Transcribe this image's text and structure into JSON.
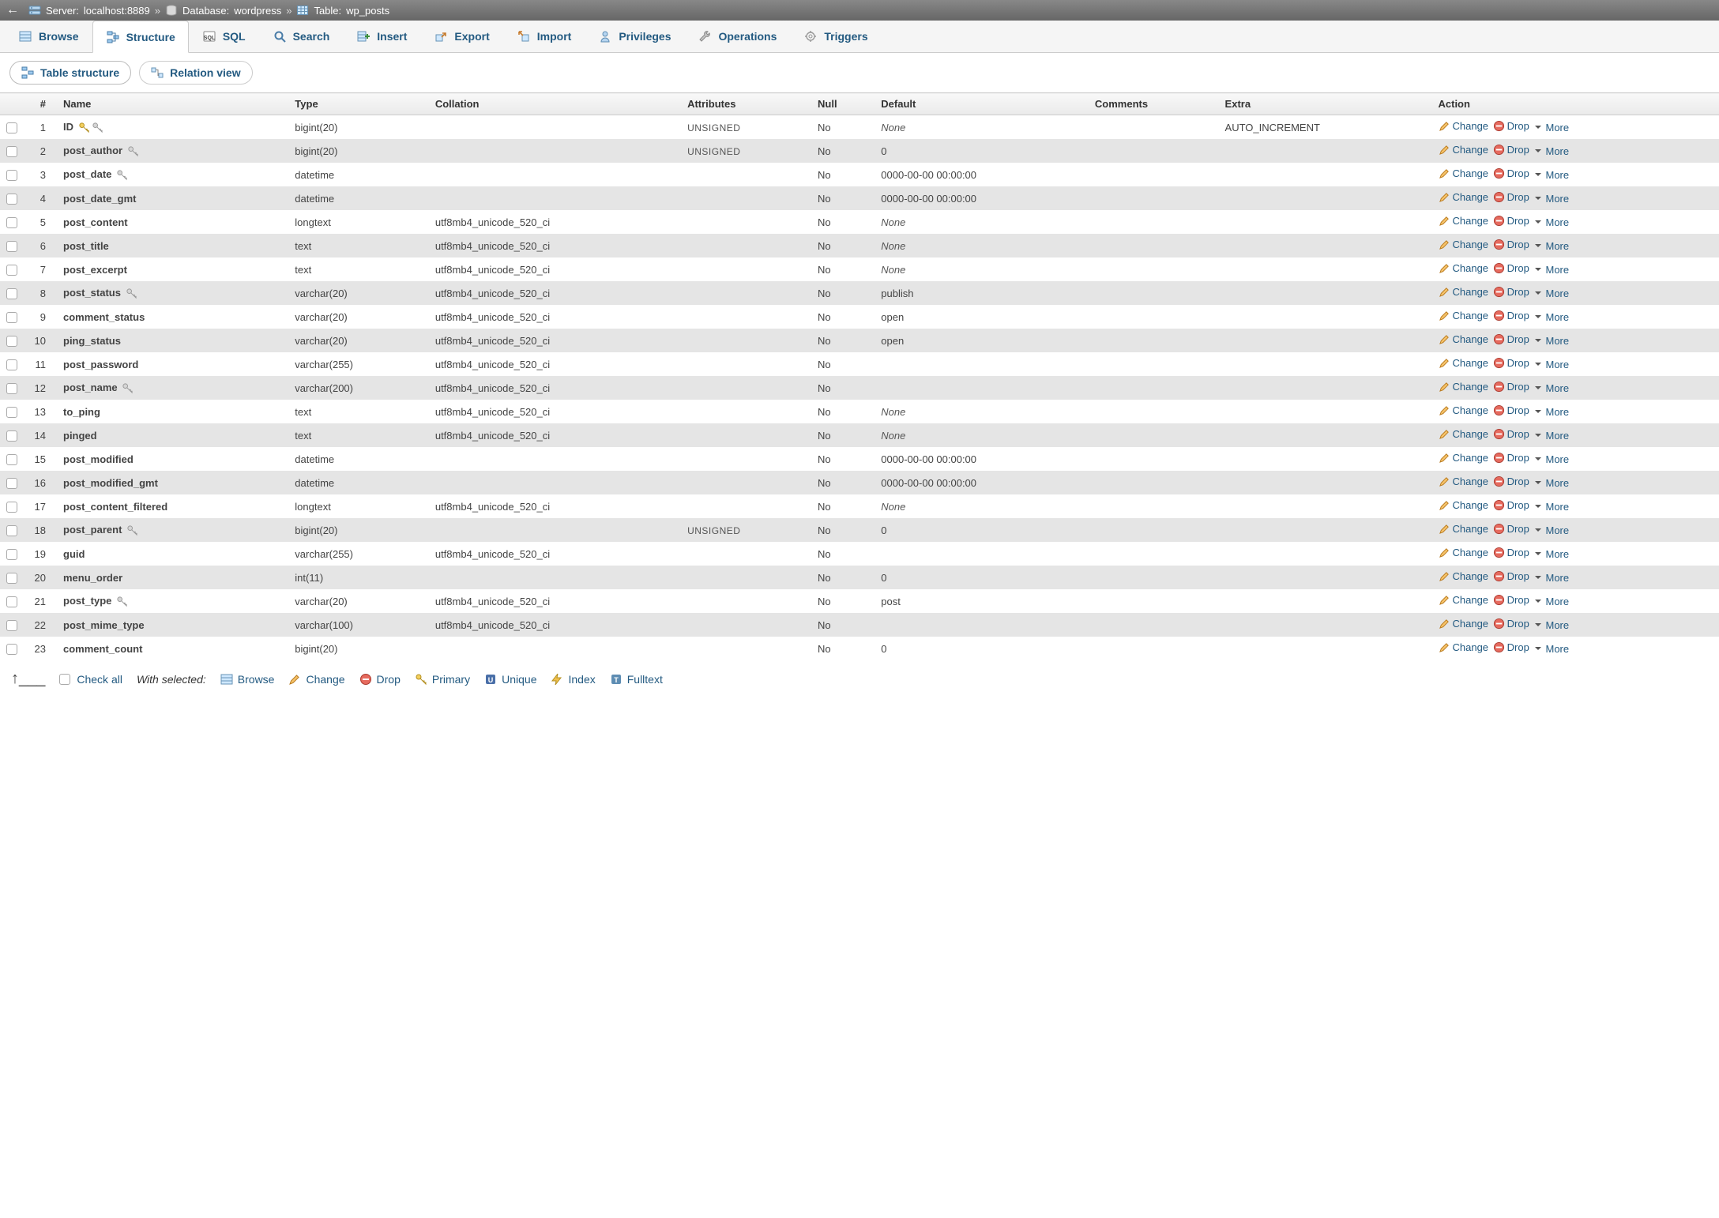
{
  "breadcrumb": {
    "server_label": "Server:",
    "server_value": "localhost:8889",
    "database_label": "Database:",
    "database_value": "wordpress",
    "table_label": "Table:",
    "table_value": "wp_posts"
  },
  "topnav": {
    "browse": "Browse",
    "structure": "Structure",
    "sql": "SQL",
    "search": "Search",
    "insert": "Insert",
    "export": "Export",
    "import": "Import",
    "privileges": "Privileges",
    "operations": "Operations",
    "triggers": "Triggers"
  },
  "subtabs": {
    "table_structure": "Table structure",
    "relation_view": "Relation view"
  },
  "headers": {
    "num": "#",
    "name": "Name",
    "type": "Type",
    "collation": "Collation",
    "attributes": "Attributes",
    "null": "Null",
    "default": "Default",
    "comments": "Comments",
    "extra": "Extra",
    "action": "Action"
  },
  "action_labels": {
    "change": "Change",
    "drop": "Drop",
    "more": "More"
  },
  "columns": [
    {
      "n": "1",
      "name": "ID",
      "type": "bigint(20)",
      "collation": "",
      "attributes": "UNSIGNED",
      "null": "No",
      "default": "None",
      "default_is_none": true,
      "extra": "AUTO_INCREMENT",
      "primary": true,
      "index": true
    },
    {
      "n": "2",
      "name": "post_author",
      "type": "bigint(20)",
      "collation": "",
      "attributes": "UNSIGNED",
      "null": "No",
      "default": "0",
      "default_is_none": false,
      "extra": "",
      "index": true
    },
    {
      "n": "3",
      "name": "post_date",
      "type": "datetime",
      "collation": "",
      "attributes": "",
      "null": "No",
      "default": "0000-00-00 00:00:00",
      "default_is_none": false,
      "extra": "",
      "index": true
    },
    {
      "n": "4",
      "name": "post_date_gmt",
      "type": "datetime",
      "collation": "",
      "attributes": "",
      "null": "No",
      "default": "0000-00-00 00:00:00",
      "default_is_none": false,
      "extra": ""
    },
    {
      "n": "5",
      "name": "post_content",
      "type": "longtext",
      "collation": "utf8mb4_unicode_520_ci",
      "attributes": "",
      "null": "No",
      "default": "None",
      "default_is_none": true,
      "extra": ""
    },
    {
      "n": "6",
      "name": "post_title",
      "type": "text",
      "collation": "utf8mb4_unicode_520_ci",
      "attributes": "",
      "null": "No",
      "default": "None",
      "default_is_none": true,
      "extra": ""
    },
    {
      "n": "7",
      "name": "post_excerpt",
      "type": "text",
      "collation": "utf8mb4_unicode_520_ci",
      "attributes": "",
      "null": "No",
      "default": "None",
      "default_is_none": true,
      "extra": ""
    },
    {
      "n": "8",
      "name": "post_status",
      "type": "varchar(20)",
      "collation": "utf8mb4_unicode_520_ci",
      "attributes": "",
      "null": "No",
      "default": "publish",
      "default_is_none": false,
      "extra": "",
      "index": true
    },
    {
      "n": "9",
      "name": "comment_status",
      "type": "varchar(20)",
      "collation": "utf8mb4_unicode_520_ci",
      "attributes": "",
      "null": "No",
      "default": "open",
      "default_is_none": false,
      "extra": ""
    },
    {
      "n": "10",
      "name": "ping_status",
      "type": "varchar(20)",
      "collation": "utf8mb4_unicode_520_ci",
      "attributes": "",
      "null": "No",
      "default": "open",
      "default_is_none": false,
      "extra": ""
    },
    {
      "n": "11",
      "name": "post_password",
      "type": "varchar(255)",
      "collation": "utf8mb4_unicode_520_ci",
      "attributes": "",
      "null": "No",
      "default": "",
      "default_is_none": false,
      "extra": ""
    },
    {
      "n": "12",
      "name": "post_name",
      "type": "varchar(200)",
      "collation": "utf8mb4_unicode_520_ci",
      "attributes": "",
      "null": "No",
      "default": "",
      "default_is_none": false,
      "extra": "",
      "index": true
    },
    {
      "n": "13",
      "name": "to_ping",
      "type": "text",
      "collation": "utf8mb4_unicode_520_ci",
      "attributes": "",
      "null": "No",
      "default": "None",
      "default_is_none": true,
      "extra": ""
    },
    {
      "n": "14",
      "name": "pinged",
      "type": "text",
      "collation": "utf8mb4_unicode_520_ci",
      "attributes": "",
      "null": "No",
      "default": "None",
      "default_is_none": true,
      "extra": ""
    },
    {
      "n": "15",
      "name": "post_modified",
      "type": "datetime",
      "collation": "",
      "attributes": "",
      "null": "No",
      "default": "0000-00-00 00:00:00",
      "default_is_none": false,
      "extra": ""
    },
    {
      "n": "16",
      "name": "post_modified_gmt",
      "type": "datetime",
      "collation": "",
      "attributes": "",
      "null": "No",
      "default": "0000-00-00 00:00:00",
      "default_is_none": false,
      "extra": ""
    },
    {
      "n": "17",
      "name": "post_content_filtered",
      "type": "longtext",
      "collation": "utf8mb4_unicode_520_ci",
      "attributes": "",
      "null": "No",
      "default": "None",
      "default_is_none": true,
      "extra": ""
    },
    {
      "n": "18",
      "name": "post_parent",
      "type": "bigint(20)",
      "collation": "",
      "attributes": "UNSIGNED",
      "null": "No",
      "default": "0",
      "default_is_none": false,
      "extra": "",
      "index": true
    },
    {
      "n": "19",
      "name": "guid",
      "type": "varchar(255)",
      "collation": "utf8mb4_unicode_520_ci",
      "attributes": "",
      "null": "No",
      "default": "",
      "default_is_none": false,
      "extra": ""
    },
    {
      "n": "20",
      "name": "menu_order",
      "type": "int(11)",
      "collation": "",
      "attributes": "",
      "null": "No",
      "default": "0",
      "default_is_none": false,
      "extra": ""
    },
    {
      "n": "21",
      "name": "post_type",
      "type": "varchar(20)",
      "collation": "utf8mb4_unicode_520_ci",
      "attributes": "",
      "null": "No",
      "default": "post",
      "default_is_none": false,
      "extra": "",
      "index": true
    },
    {
      "n": "22",
      "name": "post_mime_type",
      "type": "varchar(100)",
      "collation": "utf8mb4_unicode_520_ci",
      "attributes": "",
      "null": "No",
      "default": "",
      "default_is_none": false,
      "extra": ""
    },
    {
      "n": "23",
      "name": "comment_count",
      "type": "bigint(20)",
      "collation": "",
      "attributes": "",
      "null": "No",
      "default": "0",
      "default_is_none": false,
      "extra": ""
    }
  ],
  "bottom": {
    "check_all": "Check all",
    "with_selected": "With selected:",
    "browse": "Browse",
    "change": "Change",
    "drop": "Drop",
    "primary": "Primary",
    "unique": "Unique",
    "index": "Index",
    "fulltext": "Fulltext"
  }
}
